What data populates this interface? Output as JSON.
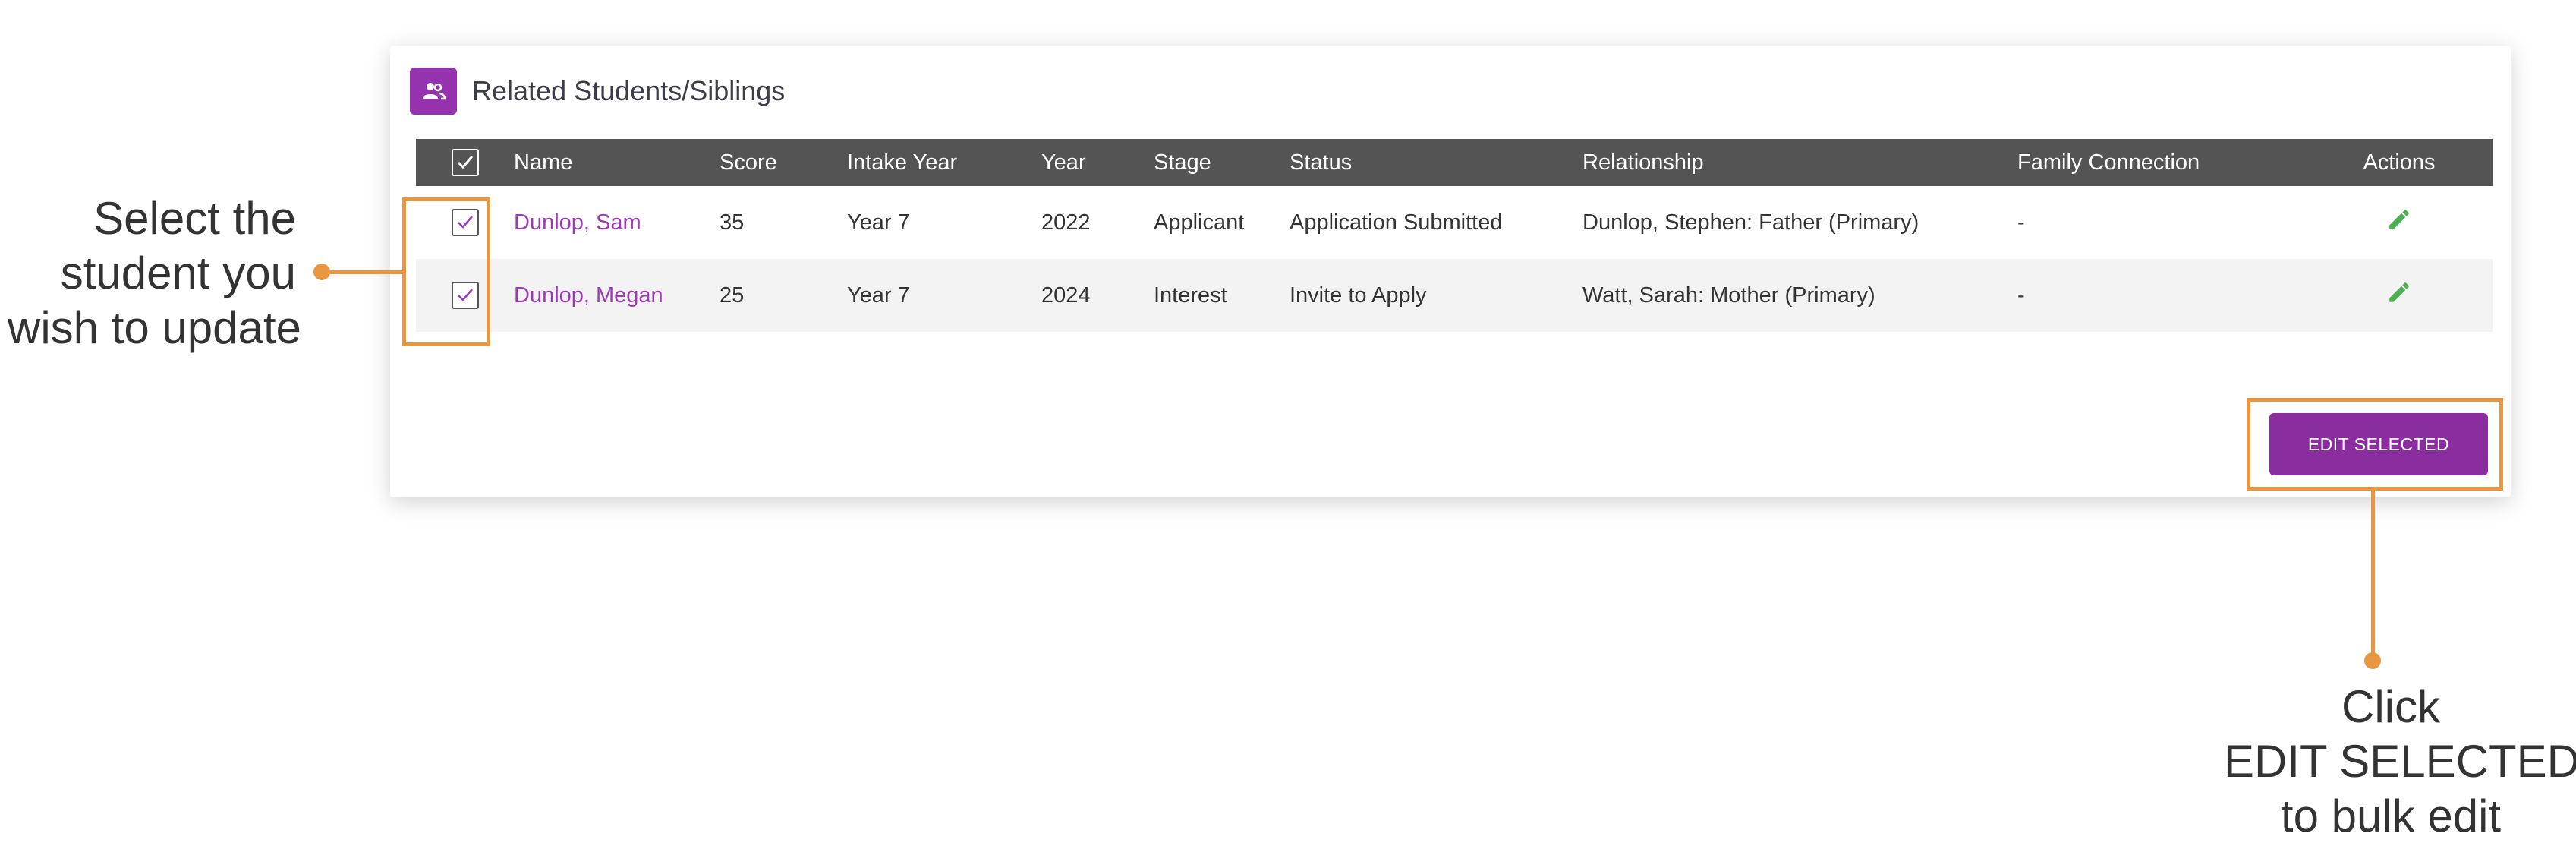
{
  "panel": {
    "title": "Related Students/Siblings",
    "icon": "people-icon"
  },
  "table": {
    "columns": [
      "Name",
      "Score",
      "Intake Year",
      "Year",
      "Stage",
      "Status",
      "Relationship",
      "Family Connection",
      "Actions"
    ],
    "rows": [
      {
        "name": "Dunlop, Sam",
        "score": "35",
        "intake_year": "Year 7",
        "year": "2022",
        "stage": "Applicant",
        "status": "Application Submitted",
        "relationship": "Dunlop, Stephen: Father (Primary)",
        "family_connection": "-",
        "checked": true
      },
      {
        "name": "Dunlop, Megan",
        "score": "25",
        "intake_year": "Year 7",
        "year": "2024",
        "stage": "Interest",
        "status": "Invite to Apply",
        "relationship": "Watt, Sarah: Mother (Primary)",
        "family_connection": "-",
        "checked": true
      }
    ]
  },
  "buttons": {
    "edit_selected": "EDIT SELECTED"
  },
  "annotations": {
    "left": [
      "Select the",
      "student you",
      "wish to update"
    ],
    "right": [
      "Click",
      "EDIT SELECTED",
      "to bulk edit"
    ]
  },
  "colors": {
    "accent": "#9433ad",
    "highlight": "#e8963f",
    "header_bg": "#545454",
    "edit_green": "#4caf50"
  }
}
